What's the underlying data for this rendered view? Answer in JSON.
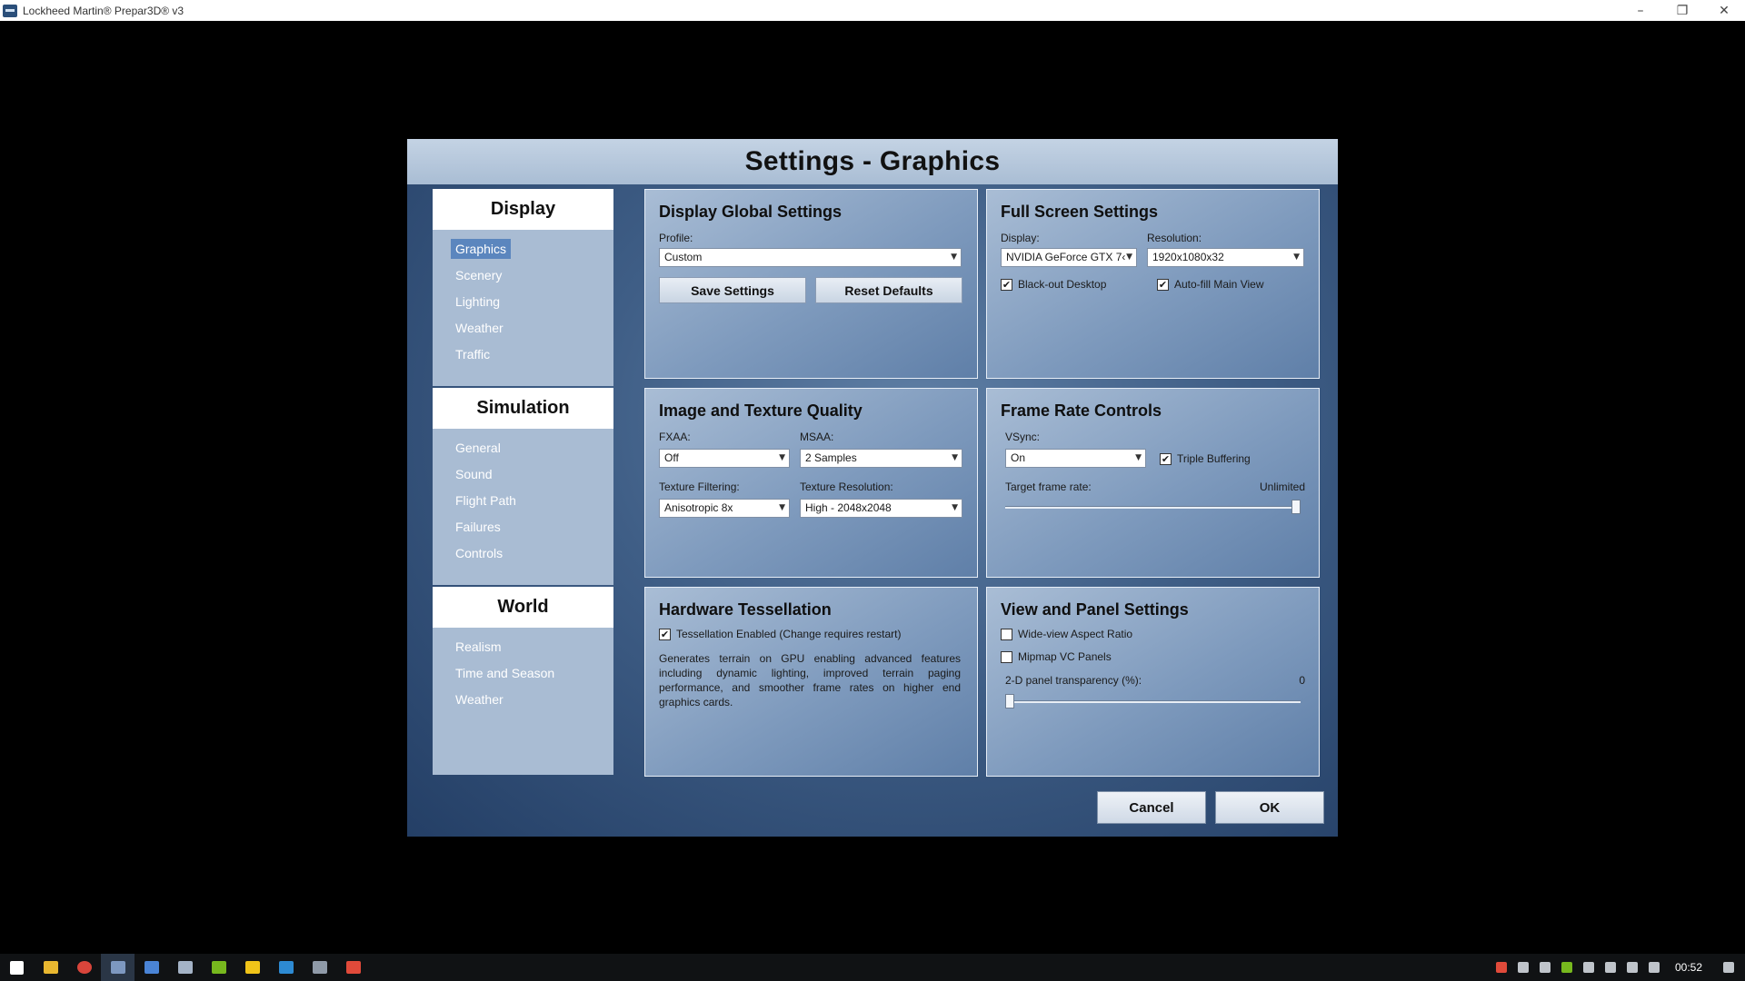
{
  "window": {
    "title": "Lockheed Martin® Prepar3D® v3",
    "minimize": "–",
    "restore": "❐",
    "close": "✕"
  },
  "dialog": {
    "title": "Settings - Graphics"
  },
  "nav": {
    "display": {
      "title": "Display",
      "items": [
        "Graphics",
        "Scenery",
        "Lighting",
        "Weather",
        "Traffic"
      ],
      "active": "Graphics"
    },
    "simulation": {
      "title": "Simulation",
      "items": [
        "General",
        "Sound",
        "Flight Path",
        "Failures",
        "Controls"
      ]
    },
    "world": {
      "title": "World",
      "items": [
        "Realism",
        "Time and Season",
        "Weather"
      ]
    }
  },
  "global": {
    "title": "Display Global Settings",
    "profile_label": "Profile:",
    "profile_value": "Custom",
    "save_label": "Save Settings",
    "reset_label": "Reset Defaults"
  },
  "fullscreen": {
    "title": "Full Screen Settings",
    "display_label": "Display:",
    "display_value": "NVIDIA GeForce GTX 7‹",
    "resolution_label": "Resolution:",
    "resolution_value": "1920x1080x32",
    "blackout_label": "Black-out Desktop",
    "blackout_checked": true,
    "autofill_label": "Auto-fill Main View",
    "autofill_checked": true
  },
  "image": {
    "title": "Image and Texture Quality",
    "fxaa_label": "FXAA:",
    "fxaa_value": "Off",
    "msaa_label": "MSAA:",
    "msaa_value": "2 Samples",
    "filtering_label": "Texture Filtering:",
    "filtering_value": "Anisotropic 8x",
    "resolution_label": "Texture Resolution:",
    "resolution_value": "High - 2048x2048"
  },
  "framerate": {
    "title": "Frame Rate Controls",
    "vsync_label": "VSync:",
    "vsync_value": "On",
    "triple_label": "Triple Buffering",
    "triple_checked": true,
    "target_label": "Target frame rate:",
    "target_value": "Unlimited",
    "target_fraction": 1.0
  },
  "tessellation": {
    "title": "Hardware Tessellation",
    "enabled_label": "Tessellation Enabled (Change requires restart)",
    "enabled_checked": true,
    "description": "Generates terrain on GPU enabling advanced features including dynamic lighting, improved terrain paging performance, and smoother frame rates on higher end graphics cards."
  },
  "viewpanel": {
    "title": "View and Panel Settings",
    "wideview_label": "Wide-view Aspect Ratio",
    "wideview_checked": false,
    "mipmap_label": "Mipmap VC Panels",
    "mipmap_checked": false,
    "transparency_label": "2-D panel transparency (%):",
    "transparency_value": "0",
    "transparency_fraction": 0.0
  },
  "actions": {
    "cancel_label": "Cancel",
    "ok_label": "OK"
  },
  "taskbar": {
    "clock": "00:52",
    "apps": [
      "start-icon",
      "file-explorer-icon",
      "chrome-icon",
      "prepar3d-icon",
      "planner-icon",
      "monitor-icon",
      "nvidia-icon",
      "app-icon",
      "app-icon",
      "app-icon",
      "app-icon"
    ]
  }
}
